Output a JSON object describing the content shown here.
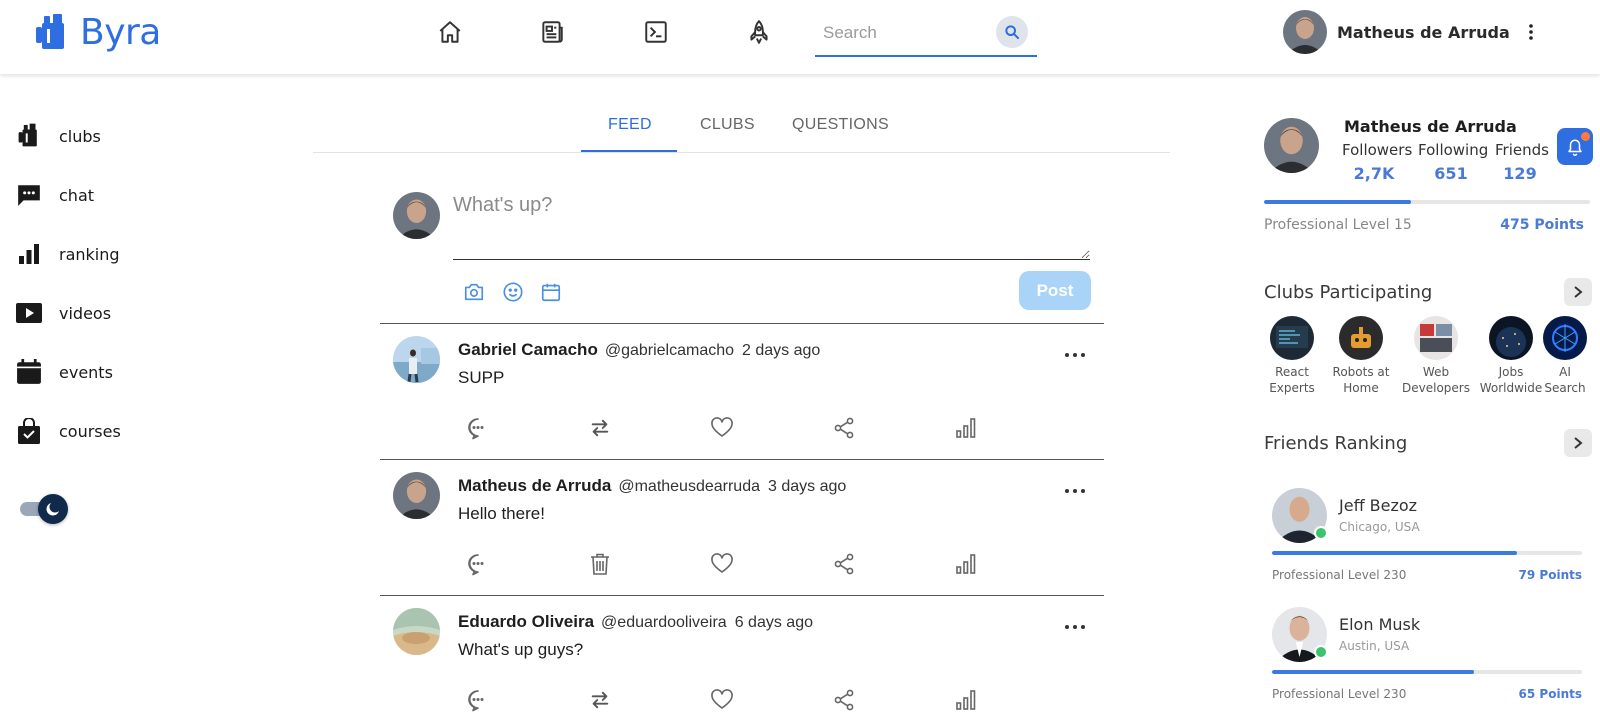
{
  "header": {
    "logo_text": "Byra",
    "search_placeholder": "Search",
    "user_name": "Matheus de Arruda",
    "accent": "#2f6ee0",
    "nav_icons": [
      "home-icon",
      "newspaper-icon",
      "terminal-icon",
      "rocket-icon"
    ]
  },
  "sidebar": {
    "items": [
      {
        "label": "clubs",
        "icon": "club-tower-icon"
      },
      {
        "label": "chat",
        "icon": "chat-bubble-icon"
      },
      {
        "label": "ranking",
        "icon": "bar-chart-icon"
      },
      {
        "label": "videos",
        "icon": "play-icon"
      },
      {
        "label": "events",
        "icon": "calendar-icon"
      },
      {
        "label": "courses",
        "icon": "shopping-bag-icon"
      }
    ],
    "dark_mode_toggle": "on"
  },
  "tabs": [
    {
      "label": "FEED",
      "active": true
    },
    {
      "label": "CLUBS",
      "active": false
    },
    {
      "label": "QUESTIONS",
      "active": false
    }
  ],
  "composer": {
    "placeholder": "What's up?",
    "post_label": "Post",
    "tools": [
      "camera-icon",
      "smile-icon",
      "calendar-icon"
    ]
  },
  "posts": [
    {
      "name": "Gabriel Camacho",
      "handle": "@gabrielcamacho",
      "time": "2 days ago",
      "text": "SUPP",
      "second_action": "repost-icon"
    },
    {
      "name": "Matheus de Arruda",
      "handle": "@matheusdearruda",
      "time": "3 days ago",
      "text": "Hello there!",
      "second_action": "trash-icon"
    },
    {
      "name": "Eduardo Oliveira",
      "handle": "@eduardooliveira",
      "time": "6 days ago",
      "text": "What's up guys?",
      "second_action": "repost-icon"
    }
  ],
  "profile": {
    "name": "Matheus de Arruda",
    "stats": [
      {
        "label": "Followers",
        "value": "2,7K"
      },
      {
        "label": "Following",
        "value": "651"
      },
      {
        "label": "Friends",
        "value": "129"
      }
    ],
    "level": "Professional Level 15",
    "points": "475 Points",
    "level_progress": 0.45
  },
  "clubs": {
    "title": "Clubs Participating",
    "items": [
      {
        "line1": "React",
        "line2": "Experts"
      },
      {
        "line1": "Robots at",
        "line2": "Home"
      },
      {
        "line1": "Web",
        "line2": "Developers"
      },
      {
        "line1": "Jobs",
        "line2": "Worldwide"
      },
      {
        "line1": "AI",
        "line2": "Search"
      }
    ]
  },
  "friends_ranking": {
    "title": "Friends Ranking",
    "items": [
      {
        "name": "Jeff Bezoz",
        "location": "Chicago, USA",
        "level": "Professional Level 230",
        "points": "79 Points",
        "progress": 0.79
      },
      {
        "name": "Elon Musk",
        "location": "Austin, USA",
        "level": "Professional Level 230",
        "points": "65 Points",
        "progress": 0.65
      }
    ]
  }
}
